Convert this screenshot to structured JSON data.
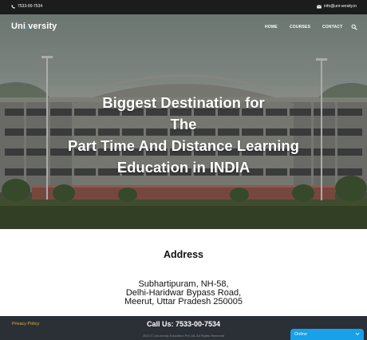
{
  "topbar": {
    "phone": "7533-00-7534",
    "email": "info@uni-versity.in",
    "phone_icon": "phone-icon",
    "email_icon": "envelope-icon"
  },
  "brand": {
    "name_prefix": "Uni",
    "name_accent": ".",
    "name_suffix": "versity",
    "accent_color": "#2bb6f0"
  },
  "nav": {
    "items": [
      "HOME",
      "COURSES",
      "CONTACT"
    ],
    "search_icon": "search-icon"
  },
  "hero": {
    "lines": [
      "Biggest Destination for",
      "The",
      "Part Time And Distance Learning",
      "Education in INDIA"
    ]
  },
  "address": {
    "title": "Address",
    "lines": [
      "Subhartipuram, NH-58,",
      "Delhi-Haridwar Bypass Road,",
      "Meerut, Uttar Pradesh 250005"
    ]
  },
  "footer": {
    "privacy_label": "Privacy Policy",
    "call_label": "Call Us: 7533-00-7534",
    "copyright": "2023 © Uni-versity Education Pvt Ltd. All Rights Reserved",
    "accent_color": "#e0b43a"
  },
  "chat": {
    "label": "Online",
    "icon": "chevron-down-icon",
    "color": "#18a0e8"
  }
}
